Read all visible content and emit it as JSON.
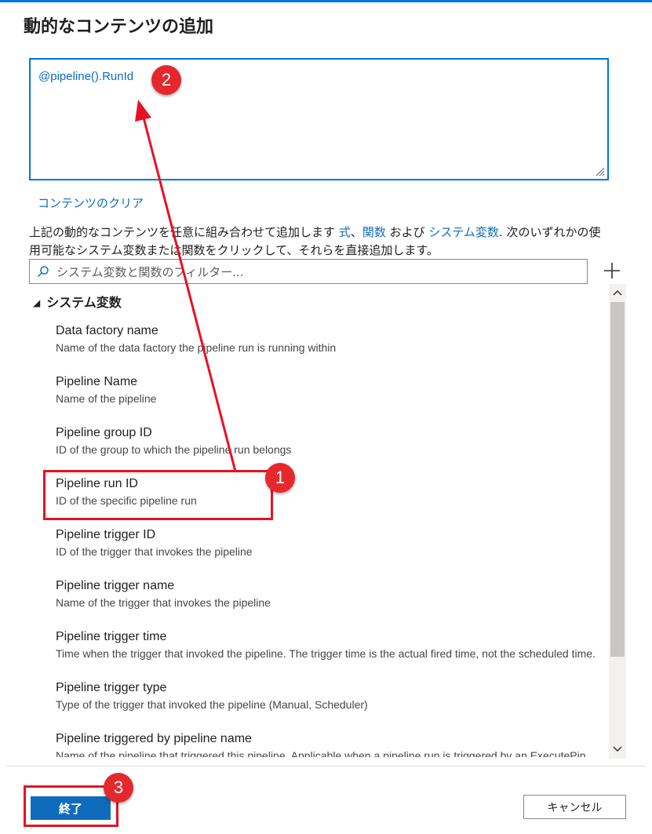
{
  "dialog": {
    "title": "動的なコンテンツの追加",
    "expression": "@pipeline().RunId",
    "clear_label": "コンテンツのクリア",
    "description": {
      "prefix": "上記の動的なコンテンツを任意に組み合わせて追加します ",
      "link1": "式",
      "sep": "、",
      "link2": "関数",
      "mid": " および ",
      "link3": "システム変数",
      "suffix": ". 次のいずれかの使用可能なシステム変数または関数をクリックして、それらを直接追加します。"
    },
    "filter_placeholder": "システム変数と関数のフィルター...",
    "group_label": "システム変数",
    "variables": [
      {
        "name": "Data factory name",
        "desc": "Name of the data factory the pipeline run is running within"
      },
      {
        "name": "Pipeline Name",
        "desc": "Name of the pipeline"
      },
      {
        "name": "Pipeline group ID",
        "desc": "ID of the group to which the pipeline run belongs"
      },
      {
        "name": "Pipeline run ID",
        "desc": "ID of the specific pipeline run"
      },
      {
        "name": "Pipeline trigger ID",
        "desc": "ID of the trigger that invokes the pipeline"
      },
      {
        "name": "Pipeline trigger name",
        "desc": "Name of the trigger that invokes the pipeline"
      },
      {
        "name": "Pipeline trigger time",
        "desc": "Time when the trigger that invoked the pipeline. The trigger time is the actual fired time, not the scheduled time."
      },
      {
        "name": "Pipeline trigger type",
        "desc": "Type of the trigger that invoked the pipeline (Manual, Scheduler)"
      },
      {
        "name": "Pipeline triggered by pipeline name",
        "desc": "Name of the pipeline that triggered this pipeline. Applicable when a pipeline run is triggered by an ExecutePipeline activity."
      }
    ],
    "finish_label": "終了",
    "cancel_label": "キャンセル"
  },
  "annotations": {
    "badge1": "1",
    "badge2": "2",
    "badge3": "3",
    "highlight_color": "#e81123"
  },
  "colors": {
    "accent": "#0078d4",
    "link": "#0f6cbd"
  },
  "icons": [
    "search-icon",
    "plus-icon",
    "collapse-triangle-icon",
    "chevron-up-icon",
    "chevron-down-icon",
    "resize-grip-icon"
  ]
}
